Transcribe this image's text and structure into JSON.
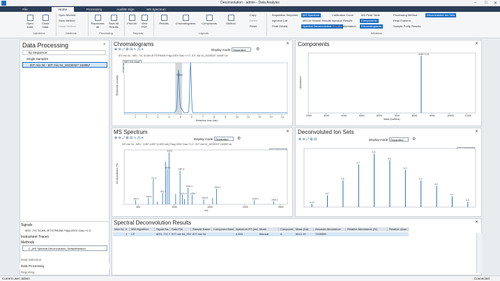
{
  "window": {
    "title": "Deconvolution - admin - Data Analysis",
    "min": "–",
    "max": "□",
    "close": "✕"
  },
  "tabs": [
    {
      "label": "File"
    },
    {
      "label": "Home"
    },
    {
      "label": "Processing"
    },
    {
      "label": "Audit/E-Sign"
    },
    {
      "label": "MS Spectrum"
    }
  ],
  "ribbon": {
    "open_data": "Open Data",
    "close_data": "Close Data",
    "open_method": "Open Method",
    "save_method": "Save Method",
    "close_method": "Close Method",
    "reprocess_all": "Reprocess All",
    "save_all_results": "Save All Results",
    "print_all": "Print All",
    "view_pdf": "View PDF",
    "results": "Results",
    "chromatograms": "Chromatograms",
    "compounds": "Compounds",
    "method": "Method",
    "copy": "Copy",
    "delete": "Delete",
    "reset": "Reset",
    "groups": {
      "injections": "Injections",
      "methods": "Methods",
      "processing": "Processing",
      "reports": "Reports",
      "layouts": "Layouts",
      "windows": "Windows"
    },
    "windows": [
      {
        "label": "Acquisition Setpoints",
        "on": false
      },
      {
        "label": "Injection List",
        "on": false
      },
      {
        "label": "Peak Details",
        "on": false
      },
      {
        "label": "MS Spectrum",
        "on": true
      },
      {
        "label": "MS Lib Search Results",
        "on": false
      },
      {
        "label": "Spectral Deconvolution Results",
        "on": true
      },
      {
        "label": "Calibration Curve",
        "on": false
      },
      {
        "label": "Injection Results",
        "on": false
      },
      {
        "label": "Sample Information",
        "on": false
      },
      {
        "label": "MS Peak Table",
        "on": false
      },
      {
        "label": "Components",
        "on": true
      },
      {
        "label": "Chromatograms",
        "on": true
      },
      {
        "label": "Processing Method",
        "on": false
      },
      {
        "label": "Peak Explorer",
        "on": false
      },
      {
        "label": "Sample Purity Results",
        "on": false
      },
      {
        "label": "Deconvoluted Ion Sets",
        "on": true
      }
    ]
  },
  "left": {
    "title": "Data Processing",
    "sort": "by Sequence",
    "tree_root": "Single Samples",
    "tree_item": "IDT mix 04 - IDT mix 04_20230327 163957",
    "signals_header": "Signals",
    "signal_item": "MS1 -TIC SCAN JETSTREAM Frag=200V Gas=+1.0",
    "instrument_traces": "Instrument Traces",
    "methods_header": "Methods",
    "method_item": "C_MS Spectral Deconvolution_DefaultMethod",
    "data_selection": "Data Selection",
    "data_processing": "Data Processing",
    "reporting": "Reporting"
  },
  "chromatograms": {
    "title": "Chromatograms",
    "display_mode_label": "Display mode",
    "display_mode": "Separated",
    "trace_label": "IDT mix 04 - MS1 -TIC SCAN JETSTREAM Frag=200V Gas=+1.0 - IDT mix 04_20230327 163957.dx",
    "legend": [
      "MS1 full range",
      "TIC peak width",
      "Peak labels"
    ],
    "peak_label": "4.833",
    "ylabel": "Response (counts)",
    "xlabel": "Retention time (min)"
  },
  "components": {
    "title": "Components",
    "peak_label": "4.84 r 1.0",
    "ylabel": "Abundance",
    "xlabel": "Mass (Daltons)"
  },
  "ms_spectrum": {
    "title": "MS Spectrum",
    "display_mode_label": "Display mode",
    "display_mode": "Separated",
    "trace_label": "IDT mix 04 - MS1 - 4.857-4.897 (4.833 min) Frag=200V Gas=+1.0 - IDT mix 04_20230327 163957.dx",
    "max_label": "Max: 1601944",
    "ylabel": "Ion Abundance (%)",
    "xlabel": "m/z"
  },
  "deconv_ion_sets": {
    "title": "Deconvoluted Ion Sets",
    "display_mode_label": "Display mode",
    "display_mode": "Separated",
    "max_label": "Max: 1665842"
  },
  "sdr": {
    "title": "Spectral Deconvolution Results",
    "columns": [
      "Inter No",
      "#",
      "MW Algorithm",
      "Signal Na...",
      "Data File",
      "Sample Name",
      "Compound Name",
      "Spectrum RT (min)",
      "Mode",
      "Component",
      "Mass (Da)",
      "Absolute Abundance",
      "Relative Abundance (%)",
      "Relative Quan"
    ],
    "row": [
      "",
      "1",
      "CF",
      "MS1 -TIC SCAN J...",
      "IDT mix 04_2023...",
      "IDT mix 04",
      "",
      "4.833",
      "Manual",
      "A",
      "8412.19",
      "7209559",
      "",
      ""
    ]
  },
  "status": {
    "user": "Current user: admin",
    "state": "Connected"
  },
  "chart_data": [
    {
      "type": "line",
      "title": "Chromatograms",
      "xlabel": "Retention time (min)",
      "ylabel": "Response (counts)",
      "x_ticks": [
        "1",
        "2",
        "3",
        "4",
        "5",
        "6",
        "7",
        "8",
        "9",
        "10",
        "11",
        "12",
        "13",
        "14"
      ],
      "peaks": [
        {
          "x": 4.83,
          "y": 0.72,
          "label": "4.833"
        },
        {
          "x": 5.9,
          "y": 0.98,
          "label": ""
        }
      ],
      "xlim": [
        0,
        14.5
      ],
      "ylim": [
        0,
        1
      ]
    },
    {
      "type": "bar",
      "title": "Components",
      "xlabel": "Mass (Daltons)",
      "ylabel": "Abundance",
      "x_ticks": [
        "2000",
        "3000",
        "4000",
        "5000",
        "6000",
        "7000",
        "8000",
        "9000",
        "10000",
        "11000"
      ],
      "x": [
        8412
      ],
      "values": [
        1.0
      ],
      "xlim": [
        2000,
        11500
      ],
      "ylim": [
        0,
        1.05
      ]
    },
    {
      "type": "bar",
      "title": "MS Spectrum",
      "xlabel": "m/z",
      "ylabel": "Ion Abundance (%)",
      "x_ticks": [
        "500",
        "1000",
        "1500",
        "2000",
        "2500"
      ],
      "x": [
        461.3,
        643.2,
        711.6,
        766.2,
        842,
        885.5,
        908.6,
        935,
        1026,
        1087.8,
        1121.4,
        1149.6,
        1201.4,
        1258.7,
        1420.6,
        1547,
        1602.1,
        2136.1,
        2406.6
      ],
      "values": [
        0.08,
        0.12,
        0.48,
        0.05,
        0.22,
        0.82,
        0.68,
        1.0,
        0.2,
        0.65,
        0.18,
        0.1,
        0.32,
        0.18,
        0.1,
        0.12,
        0.3,
        0.08,
        0.06
      ],
      "labels": [
        "461.3",
        "643.2",
        "711.6",
        "",
        "842.0",
        "",
        "908.6",
        "935.0",
        "",
        "1087.8",
        "1121.4",
        "",
        "1201.4",
        "1258.7",
        "1420.6",
        "",
        "1602.1",
        "2136.1",
        "2406.6"
      ],
      "xlim": [
        300,
        2600
      ],
      "ylim": [
        0,
        1.05
      ]
    },
    {
      "type": "bar",
      "title": "Deconvoluted Ion Sets",
      "x": [
        1,
        3,
        5,
        7,
        9,
        11,
        13,
        15,
        17,
        19,
        21
      ],
      "values": [
        0.06,
        0.22,
        0.5,
        0.8,
        1.0,
        0.88,
        0.7,
        0.5,
        0.4,
        0.2,
        0.1
      ],
      "labels": [
        "A-10",
        "A-9",
        "A-8",
        "A-7",
        "A-6",
        "A-5",
        "A-4",
        "A-3",
        "A-2",
        "A-1",
        "A-0"
      ],
      "xlim": [
        0,
        22
      ],
      "ylim": [
        0,
        1.1
      ]
    }
  ]
}
